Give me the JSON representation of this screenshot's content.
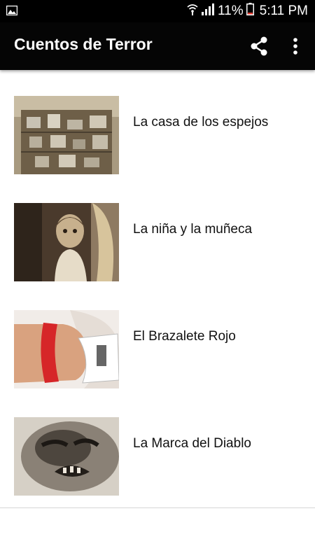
{
  "status_bar": {
    "battery": "11%",
    "time": "5:11 PM"
  },
  "app_bar": {
    "title": "Cuentos de Terror",
    "actions": [
      "share-icon",
      "more-vert-icon"
    ]
  },
  "stories": [
    {
      "title": "La casa de los espejos"
    },
    {
      "title": "La niña y la muñeca"
    },
    {
      "title": "El Brazalete Rojo"
    },
    {
      "title": "La Marca del Diablo"
    }
  ],
  "colors": {
    "app_bar": "#050505",
    "status_bar": "#000000",
    "background": "#ffffff",
    "text": "#111111"
  }
}
